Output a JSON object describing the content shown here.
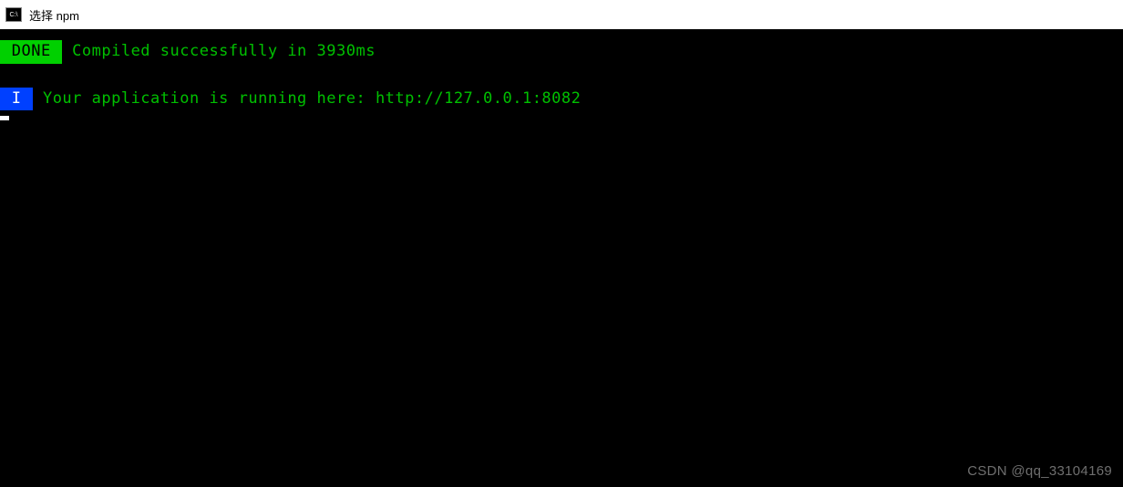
{
  "window": {
    "title": "选择 npm"
  },
  "terminal": {
    "done_label": " DONE ",
    "compiled_msg": " Compiled successfully in 3930ms",
    "info_label": " I ",
    "running_msg": " Your application is running here: http://127.0.0.1:8082"
  },
  "watermark": "CSDN @qq_33104169"
}
